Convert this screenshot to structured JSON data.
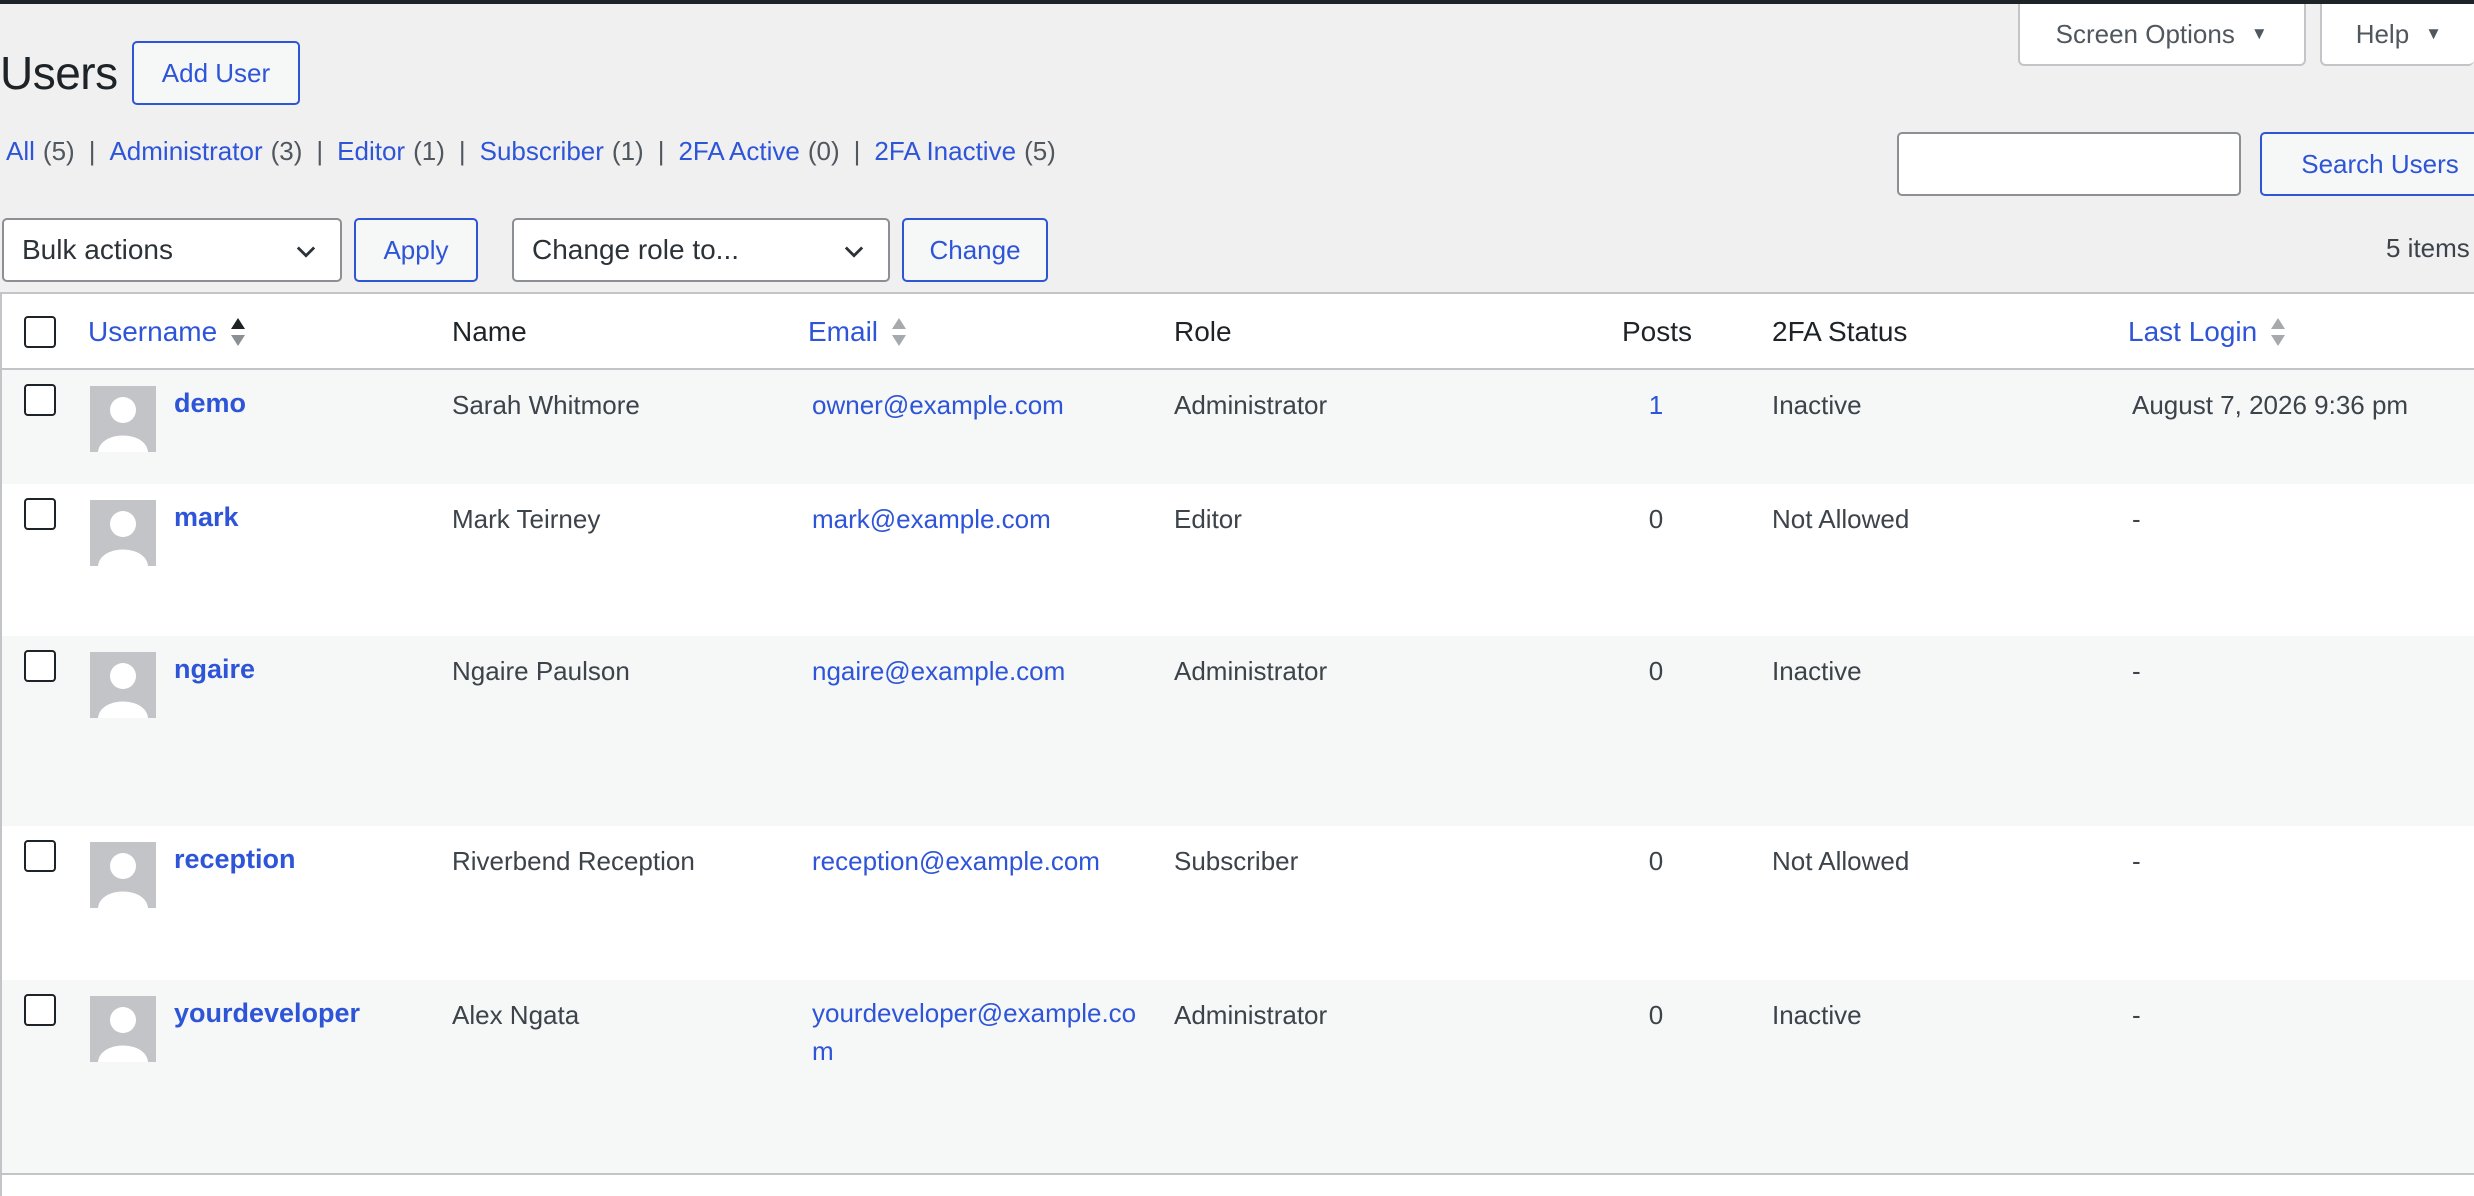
{
  "header": {
    "screen_options": "Screen Options",
    "help": "Help",
    "title": "Users",
    "add_user": "Add User"
  },
  "filters": [
    {
      "label": "All",
      "count": "(5)"
    },
    {
      "label": "Administrator",
      "count": "(3)"
    },
    {
      "label": "Editor",
      "count": "(1)"
    },
    {
      "label": "Subscriber",
      "count": "(1)"
    },
    {
      "label": "2FA Active",
      "count": "(0)"
    },
    {
      "label": "2FA Inactive",
      "count": "(5)"
    }
  ],
  "search": {
    "value": "",
    "button": "Search Users"
  },
  "bulk": {
    "selected": "Bulk actions",
    "apply": "Apply",
    "role_selected": "Change role to...",
    "change": "Change",
    "items_count": "5 items"
  },
  "columns": {
    "username": "Username",
    "name": "Name",
    "email": "Email",
    "role": "Role",
    "posts": "Posts",
    "twofa": "2FA Status",
    "last_login": "Last Login"
  },
  "rows": [
    {
      "username": "demo",
      "name": "Sarah Whitmore",
      "email": "owner@example.com",
      "role": "Administrator",
      "posts": "1",
      "twofa": "Inactive",
      "last_login": "August 7, 2026 9:36 pm"
    },
    {
      "username": "mark",
      "name": "Mark Teirney",
      "email": "mark@example.com",
      "role": "Editor",
      "posts": "0",
      "twofa": "Not Allowed",
      "last_login": "-"
    },
    {
      "username": "ngaire",
      "name": "Ngaire Paulson",
      "email": "ngaire@example.com",
      "role": "Administrator",
      "posts": "0",
      "twofa": "Inactive",
      "last_login": "-"
    },
    {
      "username": "reception",
      "name": "Riverbend Reception",
      "email": "reception@example.com",
      "role": "Subscriber",
      "posts": "0",
      "twofa": "Not Allowed",
      "last_login": "-"
    },
    {
      "username": "yourdeveloper",
      "name": "Alex Ngata",
      "email": "yourdeveloper@example.com",
      "role": "Administrator",
      "posts": "0",
      "twofa": "Inactive",
      "last_login": "-"
    }
  ],
  "colors": {
    "accent": "#2e55d8",
    "background": "#f0f0f1",
    "border": "#c3c4c7"
  }
}
